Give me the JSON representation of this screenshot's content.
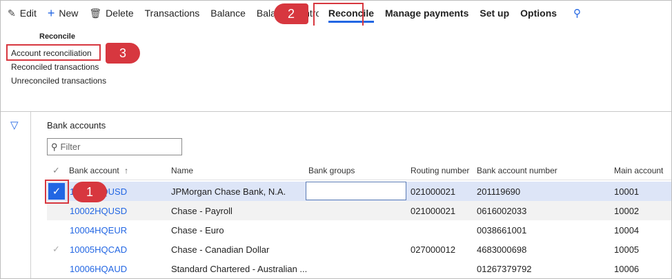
{
  "actionbar": {
    "edit": "Edit",
    "new": "New",
    "delete": "Delete",
    "transactions": "Transactions",
    "balance": "Balance",
    "balance_control": "Balance control",
    "reconcile": "Reconcile",
    "manage_payments": "Manage payments",
    "set_up": "Set up",
    "options": "Options"
  },
  "menu": {
    "group_title": "Reconcile",
    "items": [
      "Account reconciliation",
      "Reconciled transactions",
      "Unreconciled transactions"
    ]
  },
  "callouts": [
    "1",
    "2",
    "3"
  ],
  "main": {
    "title": "Bank accounts",
    "filter_placeholder": "Filter",
    "columns": [
      "Bank account",
      "Name",
      "Bank groups",
      "Routing number",
      "Bank account number",
      "Main account"
    ],
    "sort_indicator": "↑",
    "rows": [
      {
        "account": "10001HQUSD",
        "name": "JPMorgan Chase Bank, N.A.",
        "groups": "",
        "routing": "021000021",
        "number": "201119690",
        "main": "10001"
      },
      {
        "account": "10002HQUSD",
        "name": "Chase - Payroll",
        "groups": "",
        "routing": "021000021",
        "number": "0616002033",
        "main": "10002"
      },
      {
        "account": "10004HQEUR",
        "name": "Chase - Euro",
        "groups": "",
        "routing": "",
        "number": "0038661001",
        "main": "10004"
      },
      {
        "account": "10005HQCAD",
        "name": "Chase - Canadian Dollar",
        "groups": "",
        "routing": "027000012",
        "number": "4683000698",
        "main": "10005"
      },
      {
        "account": "10006HQAUD",
        "name": "Standard Chartered - Australian ...",
        "groups": "",
        "routing": "",
        "number": "01267379792",
        "main": "10006"
      }
    ]
  },
  "colors": {
    "accent": "#2266e3",
    "callout": "#d7373f",
    "selected_row": "#dde5f7"
  }
}
